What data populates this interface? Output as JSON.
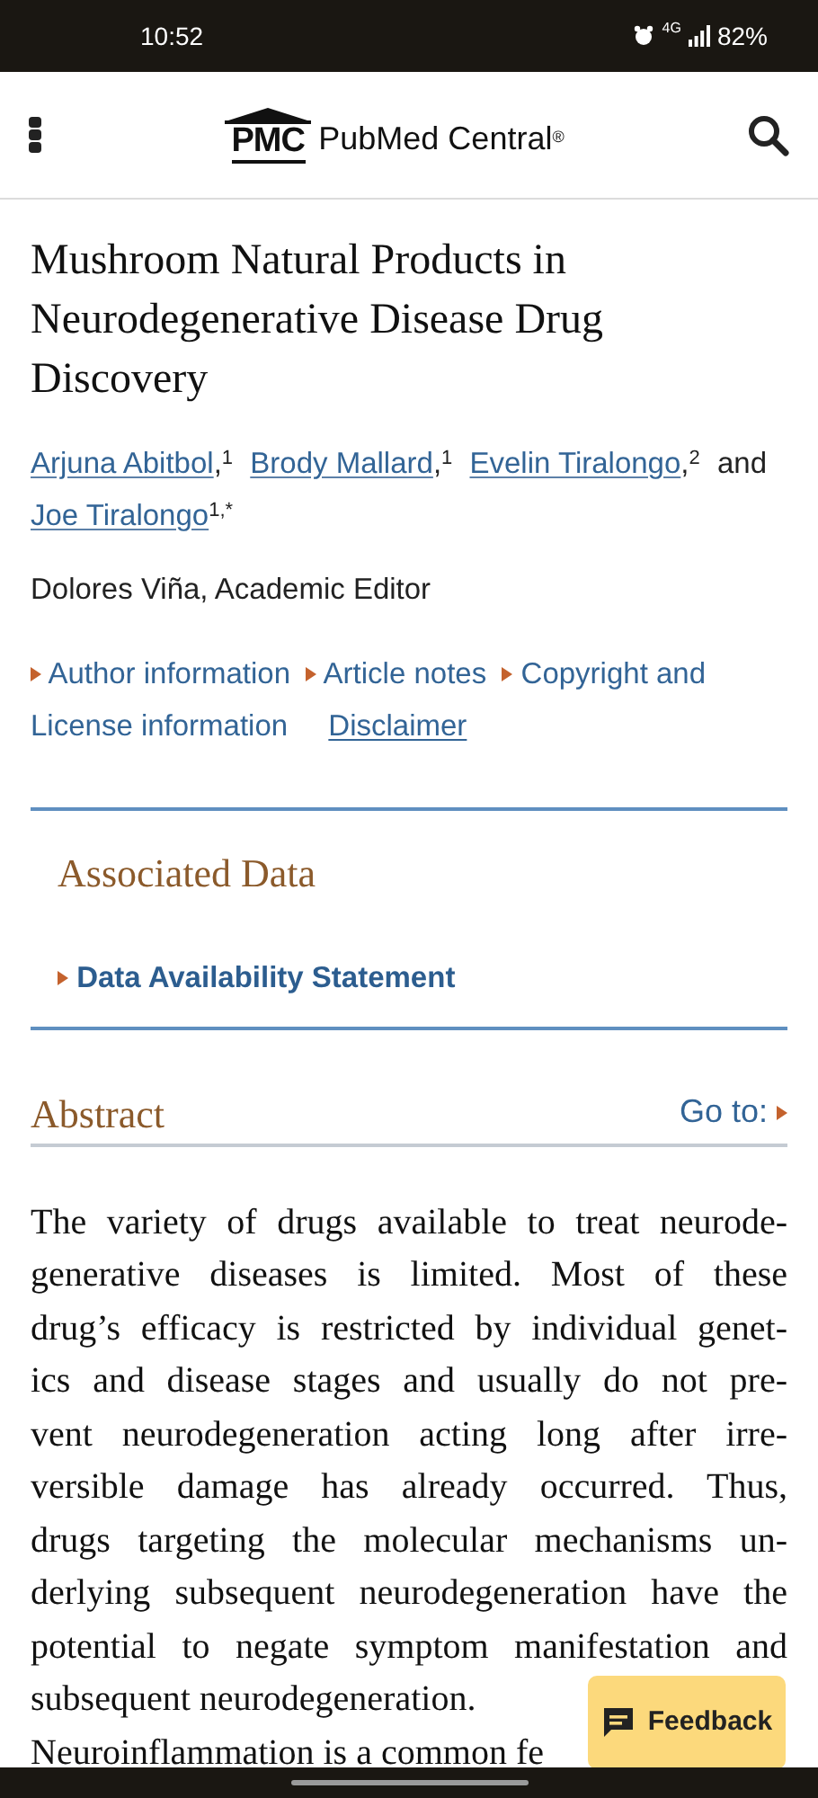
{
  "status_bar": {
    "time": "10:52",
    "network": "4G",
    "battery": "82%"
  },
  "header": {
    "logo_mark": "PMC",
    "logo_text": "PubMed Central",
    "logo_reg": "®"
  },
  "article": {
    "title": "Mushroom Natural Products in Neurodegenerative Disease Drug Discovery",
    "authors": [
      {
        "name": "Arjuna Abitbol",
        "sup": "1",
        "sep": ","
      },
      {
        "name": "Brody Mallard",
        "sup": "1",
        "sep": ","
      },
      {
        "name": "Evelin Tiralongo",
        "sup": "2",
        "sep": ","
      },
      {
        "name": "Joe Tiralongo",
        "sup": "1,*"
      }
    ],
    "authors_and": "and",
    "editor": "Dolores Viña, Academic Editor",
    "info_links": [
      {
        "label": "Author information",
        "kind": "toggle"
      },
      {
        "label": "Article notes",
        "kind": "toggle"
      },
      {
        "label": "Copyright and License information",
        "kind": "toggle"
      },
      {
        "label": "Disclaimer",
        "kind": "link"
      }
    ]
  },
  "associated_data": {
    "heading": "Associated Data",
    "items": [
      "Data Availability Statement"
    ]
  },
  "abstract": {
    "heading": "Abstract",
    "goto": "Go to:",
    "lines": [
      "The variety of drugs available to treat neurode-",
      "generative diseases is limited. Most of these",
      "drug’s efficacy is restricted by individual genet-",
      "ics and disease stages and usually do not pre-",
      "vent neurodegeneration acting long after irre-",
      "versible damage has already occurred. Thus,",
      "drugs targeting the molecular mechanisms un-",
      "derlying subsequent neurodegeneration have the",
      "potential to negate symptom manifestation and",
      "subsequent neurodegeneration.",
      "Neuroinflammation is a common fe"
    ]
  },
  "feedback_button": "Feedback"
}
